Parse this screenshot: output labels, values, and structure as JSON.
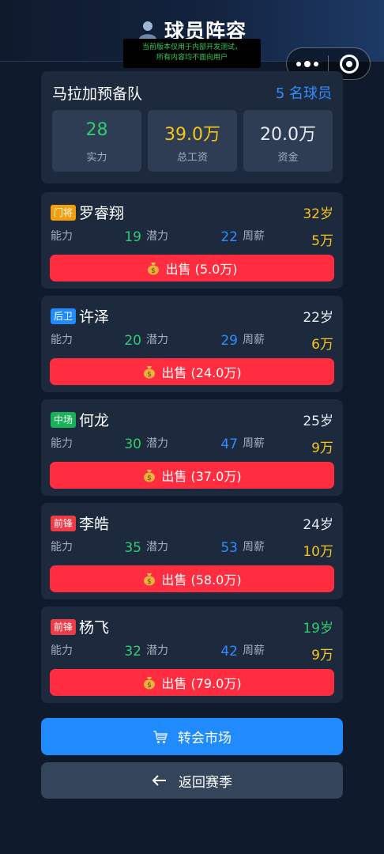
{
  "header": {
    "title": "球员阵容",
    "icon": "person-icon",
    "dev_notice_line1": "当前版本仅用于内部开发测试，",
    "dev_notice_line2": "所有内容均不面向用户"
  },
  "team": {
    "name": "马拉加预备队",
    "player_count": "5 名球员",
    "stats": [
      {
        "value": "28",
        "label": "实力",
        "color": "#2ecc71"
      },
      {
        "value": "39.0万",
        "label": "总工资",
        "color": "#f5c518"
      },
      {
        "value": "20.0万",
        "label": "资金",
        "color": "#e6ebf2"
      }
    ]
  },
  "labels": {
    "ability": "能力",
    "potential": "潜力",
    "weekly_wage": "周薪"
  },
  "players": [
    {
      "position": "门将",
      "position_color": "#f59e0b",
      "name": "罗睿翔",
      "age": "32岁",
      "age_color": "#f5c518",
      "ability": "19",
      "potential": "22",
      "wage": "5万",
      "sell_label": "出售 (5.0万)"
    },
    {
      "position": "后卫",
      "position_color": "#1f8bff",
      "name": "许泽",
      "age": "22岁",
      "age_color": "#e6ebf2",
      "ability": "20",
      "potential": "29",
      "wage": "6万",
      "sell_label": "出售 (24.0万)"
    },
    {
      "position": "中场",
      "position_color": "#16b359",
      "name": "何龙",
      "age": "25岁",
      "age_color": "#e6ebf2",
      "ability": "30",
      "potential": "47",
      "wage": "9万",
      "sell_label": "出售 (37.0万)"
    },
    {
      "position": "前锋",
      "position_color": "#ef3b45",
      "name": "李皓",
      "age": "24岁",
      "age_color": "#e6ebf2",
      "ability": "35",
      "potential": "53",
      "wage": "10万",
      "sell_label": "出售 (58.0万)"
    },
    {
      "position": "前锋",
      "position_color": "#ef3b45",
      "name": "杨飞",
      "age": "19岁",
      "age_color": "#2ecc71",
      "ability": "32",
      "potential": "42",
      "wage": "9万",
      "sell_label": "出售 (79.0万)"
    }
  ],
  "colors": {
    "ability": "#2ecc71",
    "potential": "#2e8cff",
    "wage": "#f5c518"
  },
  "actions": {
    "market_label": "转会市场",
    "back_label": "返回赛季"
  }
}
